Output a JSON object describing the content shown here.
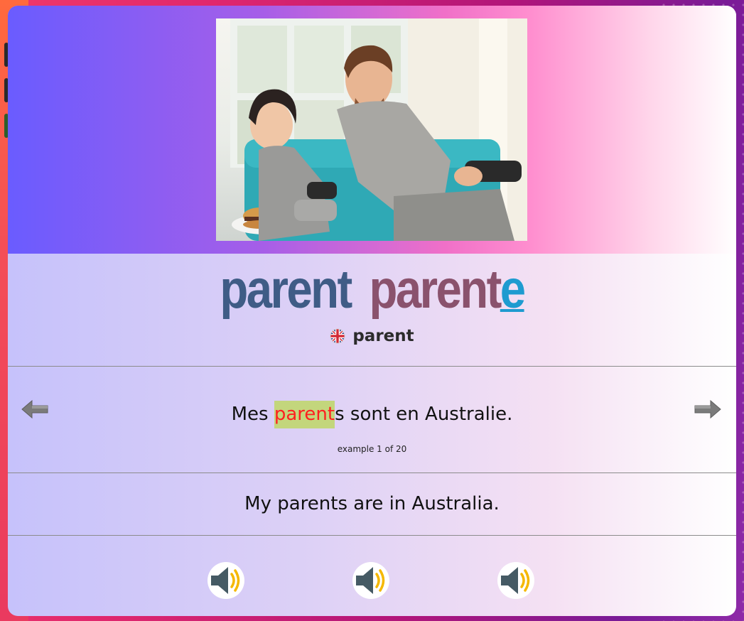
{
  "word": {
    "masculine": "parent",
    "feminine_stem": "parent",
    "feminine_ending": "e"
  },
  "translation": {
    "flag_icon": "uk-flag-icon",
    "text": "parent"
  },
  "example": {
    "before": "Mes ",
    "highlight": "parent",
    "after": "s sont en Australie.",
    "counter": "example 1 of 20",
    "translation": "My parents are in Australia."
  },
  "navigation": {
    "prev_icon": "arrow-left-icon",
    "next_icon": "arrow-right-icon"
  },
  "audio_buttons": [
    {
      "icon": "speaker-icon"
    },
    {
      "icon": "speaker-icon"
    },
    {
      "icon": "speaker-icon"
    }
  ],
  "colors": {
    "masculine": "#3f5c86",
    "feminine": "#8a526d",
    "feminine_ending": "#1e9bd0",
    "highlight_bg": "#c3d67c",
    "highlight_text": "#ff1f1f"
  }
}
